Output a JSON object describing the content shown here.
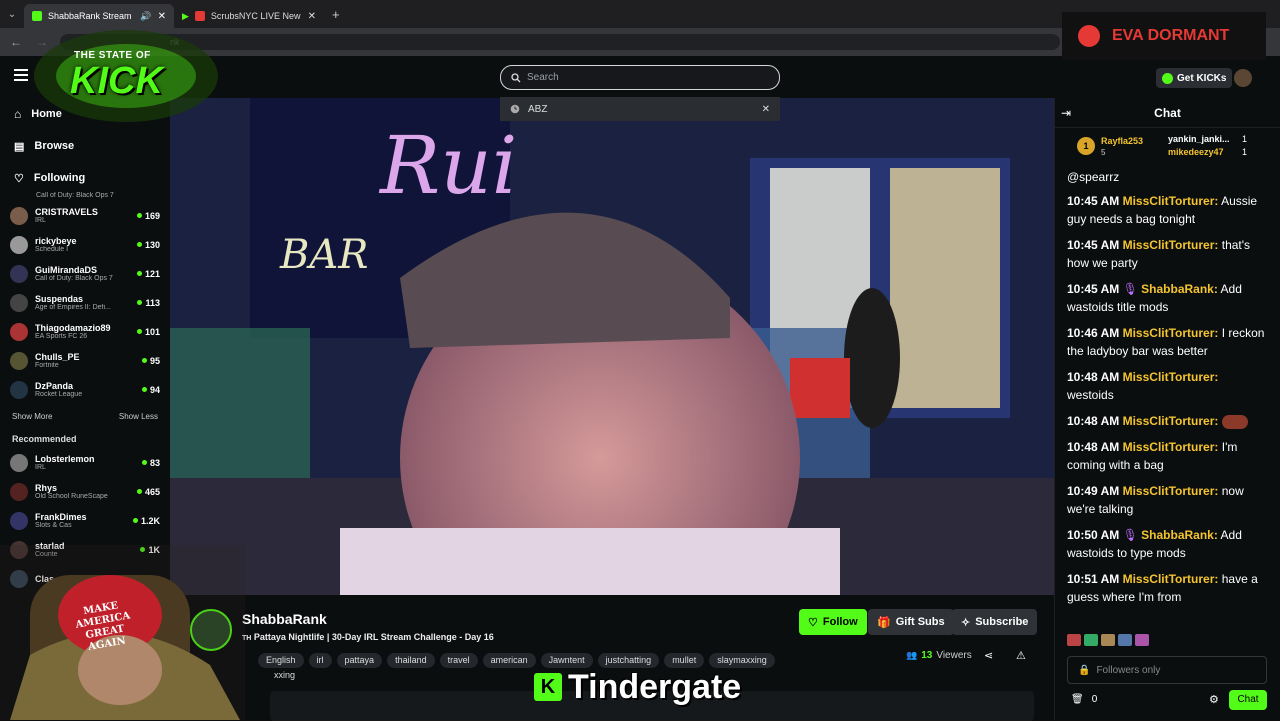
{
  "browser": {
    "tabs": [
      {
        "label": "ShabbaRank Stream - Watc",
        "active": true,
        "fav_color": "#53fc18"
      },
      {
        "label": "ScrubsNYC LIVE New York C",
        "active": false,
        "fav_color": "#e53935"
      }
    ],
    "new_tab": "+",
    "url_fragment": "nk"
  },
  "topnav": {
    "search_placeholder": "Search",
    "search_suggestion": "ABZ",
    "get_kicks": "Get KICKs"
  },
  "sidebar": {
    "nav": [
      {
        "label": "Home",
        "icon": "home-icon"
      },
      {
        "label": "Browse",
        "icon": "browse-icon"
      },
      {
        "label": "Following",
        "icon": "heart-icon"
      }
    ],
    "following_partial_cat": "Call of Duty: Black Ops 7",
    "following": [
      {
        "name": "CRISTRAVELS",
        "cat": "IRL",
        "viewers": "169",
        "color": "#7a5c4a"
      },
      {
        "name": "rickybeye",
        "cat": "Schedule I",
        "viewers": "130",
        "color": "#999"
      },
      {
        "name": "GuiMirandaDS",
        "cat": "Call of Duty: Black Ops 7",
        "viewers": "121",
        "color": "#335"
      },
      {
        "name": "Suspendas",
        "cat": "Age of Empires II: Defi...",
        "viewers": "113",
        "color": "#444"
      },
      {
        "name": "Thiagodamazio89",
        "cat": "EA Sports FC 26",
        "viewers": "101",
        "color": "#a33"
      },
      {
        "name": "Chulls_PE",
        "cat": "Fortnite",
        "viewers": "95",
        "color": "#553"
      },
      {
        "name": "DzPanda",
        "cat": "Rocket League",
        "viewers": "94",
        "color": "#234"
      }
    ],
    "show_more": "Show More",
    "show_less": "Show Less",
    "recommended_title": "Recommended",
    "recommended": [
      {
        "name": "Lobsterlemon",
        "cat": "IRL",
        "viewers": "83",
        "color": "#777"
      },
      {
        "name": "Rhys",
        "cat": "Old School RuneScape",
        "viewers": "465",
        "color": "#522"
      },
      {
        "name": "FrankDimes",
        "cat": "Slots & Cas",
        "viewers": "1.2K",
        "color": "#336"
      },
      {
        "name": "starlad",
        "cat": "Counte",
        "viewers": "1K",
        "color": "#433"
      },
      {
        "name": "Clas",
        "cat": "",
        "viewers": "",
        "color": "#345"
      }
    ]
  },
  "stream": {
    "streamer": "ShabbaRank",
    "title_prefix": "TH",
    "title": "Pattaya Nightlife | 30-Day IRL Stream Challenge - Day 16",
    "tags": [
      "English",
      "irl",
      "pattaya",
      "thailand",
      "travel",
      "american",
      "Jawntent",
      "justchatting",
      "mullet",
      "slaymaxxing"
    ],
    "tag_overflow": "xxing",
    "viewers": "13",
    "viewers_label": "Viewers",
    "follow": "Follow",
    "gift_subs": "Gift Subs",
    "subscribe": "Subscribe"
  },
  "chat": {
    "header": "Chat",
    "top_gifters": [
      {
        "name": "Rayfla253",
        "count": "5",
        "rank": "1"
      },
      {
        "name": "yankin_janki...",
        "count": "1"
      },
      {
        "name": "mikedeezy47",
        "count": "1"
      }
    ],
    "first_line": "@spearrz",
    "messages": [
      {
        "time": "10:45 AM",
        "user": "MissClitTorturer",
        "text": "Aussie guy needs a bag tonight",
        "mic": false
      },
      {
        "time": "10:45 AM",
        "user": "MissClitTorturer",
        "text": "that's how we party",
        "mic": false
      },
      {
        "time": "10:45 AM",
        "user": "ShabbaRank",
        "text": "Add wastoids title mods",
        "mic": true
      },
      {
        "time": "10:46 AM",
        "user": "MissClitTorturer",
        "text": "I reckon the ladyboy bar was better",
        "mic": false
      },
      {
        "time": "10:48 AM",
        "user": "MissClitTorturer",
        "text": "westoids",
        "mic": false
      },
      {
        "time": "10:48 AM",
        "user": "MissClitTorturer",
        "text": "",
        "mic": false,
        "emote": true
      },
      {
        "time": "10:48 AM",
        "user": "MissClitTorturer",
        "text": "I'm coming with a bag",
        "mic": false
      },
      {
        "time": "10:49 AM",
        "user": "MissClitTorturer",
        "text": "now we're talking",
        "mic": false
      },
      {
        "time": "10:50 AM",
        "user": "ShabbaRank",
        "text": "Add wastoids to type mods",
        "mic": true
      },
      {
        "time": "10:51 AM",
        "user": "MissClitTorturer",
        "text": "have a guess where I'm from",
        "mic": false
      }
    ],
    "input_placeholder": "Followers only",
    "points": "0",
    "send": "Chat"
  },
  "overlays": {
    "eva": "EVA DORMANT",
    "logo_top": "THE STATE OF",
    "logo_main": "KICK",
    "ticker": "Tindergate"
  },
  "colors": {
    "kick_green": "#53fc18",
    "eva_red": "#e53935"
  }
}
